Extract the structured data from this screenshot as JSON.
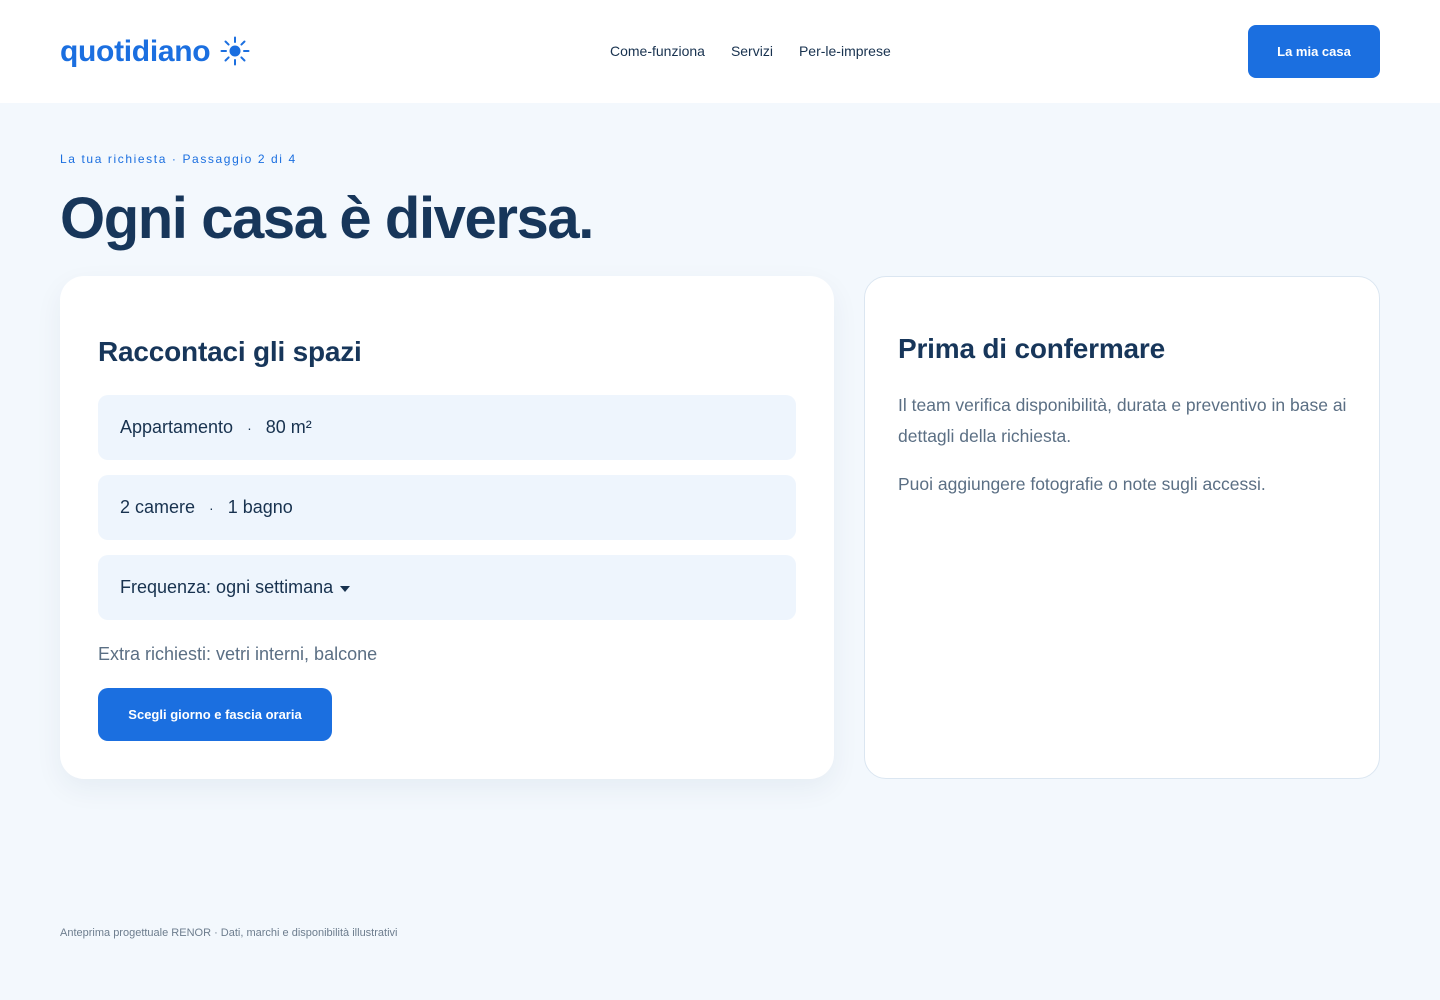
{
  "brand": {
    "name": "quotidiano",
    "icon": "sun-icon",
    "color": "#1b6fe0"
  },
  "nav": {
    "items": [
      "Come-funziona",
      "Servizi",
      "Per-le-imprese"
    ]
  },
  "header": {
    "account_button": "La mia casa"
  },
  "step": {
    "label": "La tua richiesta",
    "progress": "Passaggio 2 di 4"
  },
  "page": {
    "title": "Ogni casa è diversa."
  },
  "form": {
    "heading": "Raccontaci gli spazi",
    "property": {
      "type": "Appartamento",
      "size": "80 m²"
    },
    "rooms": {
      "bedrooms": "2 camere",
      "bathrooms": "1 bagno"
    },
    "frequency": {
      "value": "Frequenza: ogni settimana"
    },
    "extras": "Extra richiesti: vetri interni, balcone",
    "cta": "Scegli giorno e fascia oraria"
  },
  "info": {
    "heading": "Prima di confermare",
    "paragraphs": [
      "Il team verifica disponibilità, durata e preventivo in base ai dettagli della richiesta.",
      "Puoi aggiungere fotografie o note sugli accessi."
    ]
  },
  "footer": {
    "text": "Anteprima progettuale RENOR · Dati, marchi e disponibilità illustrativi"
  },
  "colors": {
    "accent": "#1b6fe0",
    "heading": "#17365a",
    "background": "#f3f8fd",
    "field": "#eef5fd",
    "muted": "#5b6f84"
  }
}
